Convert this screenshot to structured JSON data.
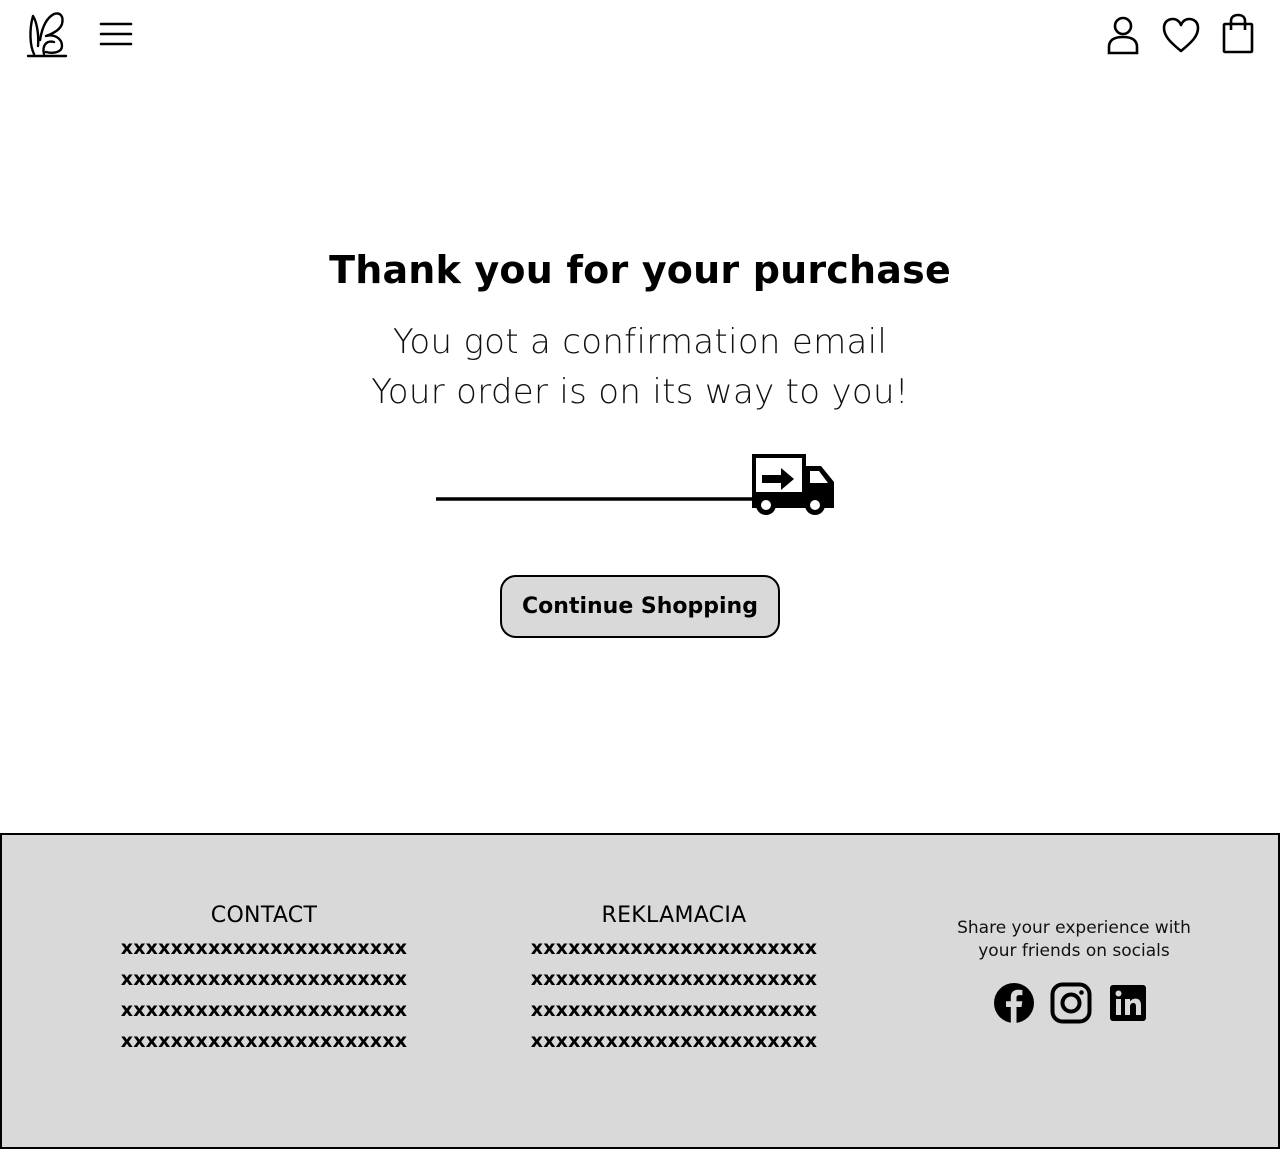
{
  "header": {
    "icons": {
      "logo": "bunny-ears-logo",
      "menu": "hamburger-menu-icon",
      "account": "user-icon",
      "wishlist": "heart-icon",
      "cart": "shopping-bag-icon"
    }
  },
  "main": {
    "title": "Thank you for your purchase",
    "subtitle_line1": "You got a confirmation email",
    "subtitle_line2": "Your order is on its way to you!",
    "continue_label": "Continue Shopping"
  },
  "footer": {
    "contact": {
      "title": "CONTACT",
      "lines": [
        "xxxxxxxxxxxxxxxxxxxxxxx",
        "xxxxxxxxxxxxxxxxxxxxxxx",
        "xxxxxxxxxxxxxxxxxxxxxxx",
        "xxxxxxxxxxxxxxxxxxxxxxx"
      ]
    },
    "reklamacia": {
      "title": "REKLAMACIA",
      "lines": [
        "xxxxxxxxxxxxxxxxxxxxxxx",
        "xxxxxxxxxxxxxxxxxxxxxxx",
        "xxxxxxxxxxxxxxxxxxxxxxx",
        "xxxxxxxxxxxxxxxxxxxxxxx"
      ]
    },
    "share_line1": "Share your experience with",
    "share_line2": "your friends on socials",
    "socials": [
      "facebook-icon",
      "instagram-icon",
      "linkedin-icon"
    ]
  },
  "colors": {
    "footer_bg": "#d9d9d9",
    "button_bg": "#d9d9d9",
    "text": "#000000"
  }
}
